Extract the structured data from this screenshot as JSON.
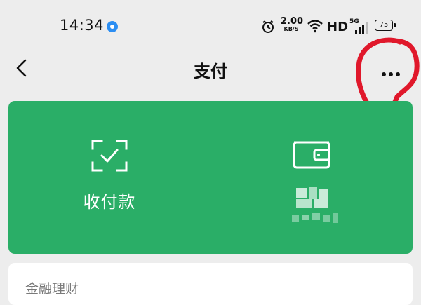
{
  "status_bar": {
    "time": "14:34",
    "net_speed": "2.00",
    "net_speed_unit": "KB/S",
    "hd": "HD",
    "network": "5G",
    "battery": "75",
    "icons": [
      "notification-dot-icon",
      "alarm-icon",
      "wifi-icon",
      "signal-icon",
      "battery-icon"
    ]
  },
  "nav": {
    "back_icon": "chevron-left-icon",
    "title": "支付",
    "more_icon": "more-dots-icon"
  },
  "payment_card": {
    "background": "#2aae67",
    "actions": [
      {
        "label": "收付款",
        "icon": "scan-check-icon"
      },
      {
        "label": "",
        "icon": "wallet-icon"
      }
    ]
  },
  "panel": {
    "title": "金融理财"
  },
  "colors": {
    "page_bg": "#ededed",
    "accent_green": "#2aae67",
    "annotation_red": "#e0182b"
  }
}
